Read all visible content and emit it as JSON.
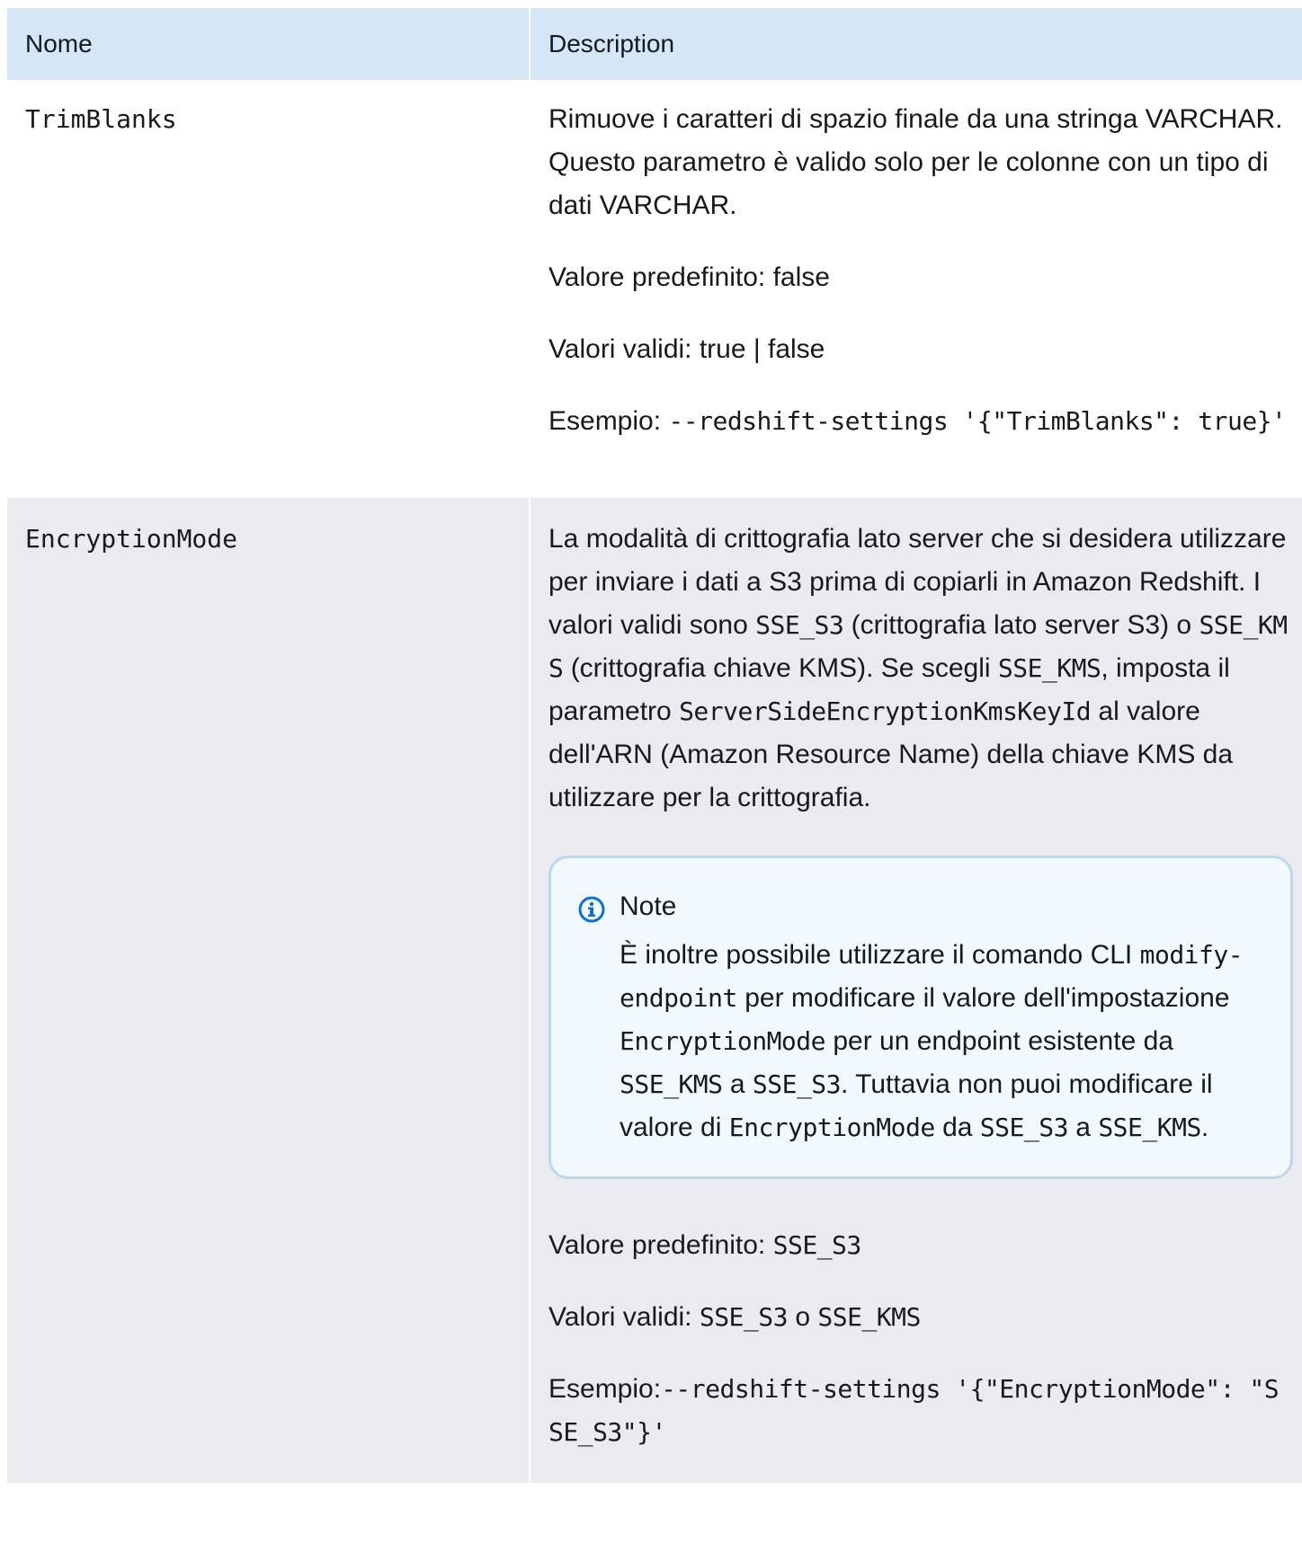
{
  "table": {
    "headers": {
      "name": "Nome",
      "description": "Description"
    },
    "rows": [
      {
        "name": "TrimBlanks",
        "description": "Rimuove i caratteri di spazio finale da una stringa VARCHAR. Questo parametro è valido solo per le colonne con un tipo di dati VARCHAR.",
        "default": "Valore predefinito: false",
        "valid": "Valori validi: true | false",
        "example_label": "Esempio: ",
        "example_code": "--redshift-settings '{\"TrimBlanks\": true}'"
      },
      {
        "name": "EncryptionMode",
        "description_parts": [
          "La modalità di crittografia lato server che si desidera utilizzare per inviare i dati a S3 prima di copiarli in Amazon Redshift. I valori validi sono ",
          "SSE_S3",
          " (crittografia lato server S3) o ",
          "SSE_KMS",
          " (crittografia chiave KMS). Se scegli ",
          "SSE_KMS",
          ", imposta il parametro ",
          "ServerSideEncryptionKmsKeyId",
          " al valore dell'ARN (Amazon Resource Name) della chiave KMS da utilizzare per la crittografia."
        ],
        "note": {
          "title": "Note",
          "parts": [
            "È inoltre possibile utilizzare il comando CLI ",
            "modify-endpoint",
            " per modificare il valore dell'impostazione ",
            "EncryptionMode",
            " per un endpoint esistente da ",
            "SSE_KMS",
            " a ",
            "SSE_S3",
            ". Tuttavia non puoi modificare il valore di ",
            "EncryptionMode",
            " da ",
            "SSE_S3",
            " a ",
            "SSE_KMS",
            "."
          ]
        },
        "default_label": "Valore predefinito: ",
        "default_code": "SSE_S3",
        "valid_label": "Valori validi: ",
        "valid_code_1": "SSE_S3",
        "valid_mid": " o ",
        "valid_code_2": "SSE_KMS",
        "example_label": "Esempio:",
        "example_code": "--redshift-settings '{\"EncryptionMode\": \"SSE_S3\"}'"
      }
    ]
  },
  "colors": {
    "header_bg": "#d5e6f7",
    "row_alt_bg": "#e9ebee",
    "note_bg": "#f1f9fe",
    "note_border": "#bdd7ef",
    "info_icon": "#0972d3"
  }
}
